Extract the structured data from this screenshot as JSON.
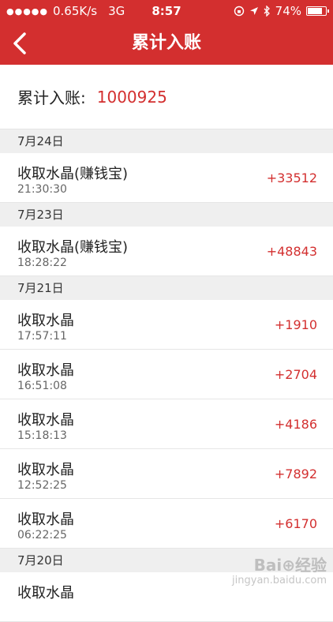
{
  "status_bar": {
    "signal": "●●●●●",
    "speed": "0.65K/s",
    "network": "3G",
    "time": "8:57",
    "battery": "74%",
    "battery_level": 0.74
  },
  "nav": {
    "back_icon": "chevron-left-icon",
    "title": "累计入账"
  },
  "summary": {
    "label": "累计入账:",
    "value": "1000925"
  },
  "groups": [
    {
      "date": "7月24日",
      "items": [
        {
          "title": "收取水晶(赚钱宝)",
          "time": "21:30:30",
          "amount": "+33512"
        }
      ]
    },
    {
      "date": "7月23日",
      "items": [
        {
          "title": "收取水晶(赚钱宝)",
          "time": "18:28:22",
          "amount": "+48843"
        }
      ]
    },
    {
      "date": "7月21日",
      "items": [
        {
          "title": "收取水晶",
          "time": "17:57:11",
          "amount": "+1910"
        },
        {
          "title": "收取水晶",
          "time": "16:51:08",
          "amount": "+2704"
        },
        {
          "title": "收取水晶",
          "time": "15:18:13",
          "amount": "+4186"
        },
        {
          "title": "收取水晶",
          "time": "12:52:25",
          "amount": "+7892"
        },
        {
          "title": "收取水晶",
          "time": "06:22:25",
          "amount": "+6170"
        }
      ]
    },
    {
      "date": "7月20日",
      "items": [
        {
          "title": "收取水晶",
          "time": "",
          "amount": ""
        }
      ]
    }
  ],
  "watermark": {
    "logo": "Bai⊕经验",
    "url": "jingyan.baidu.com"
  },
  "colors": {
    "accent": "#d32f2f"
  }
}
